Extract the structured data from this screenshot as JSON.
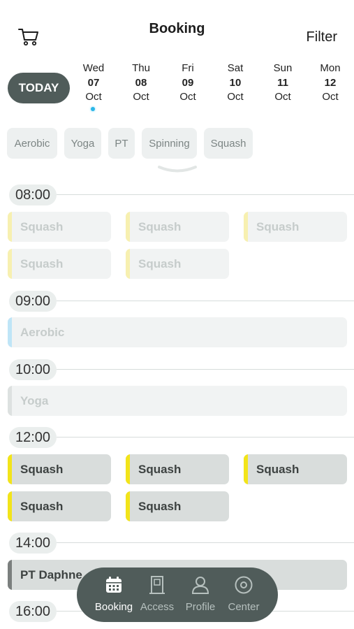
{
  "header": {
    "title": "Booking",
    "filter_label": "Filter",
    "cart_icon": "cart-icon"
  },
  "date_strip": {
    "today_label": "TODAY",
    "selected_index": 0,
    "days": [
      {
        "weekday": "Wed",
        "date": "07",
        "month": "Oct"
      },
      {
        "weekday": "Thu",
        "date": "08",
        "month": "Oct"
      },
      {
        "weekday": "Fri",
        "date": "09",
        "month": "Oct"
      },
      {
        "weekday": "Sat",
        "date": "10",
        "month": "Oct"
      },
      {
        "weekday": "Sun",
        "date": "11",
        "month": "Oct"
      },
      {
        "weekday": "Mon",
        "date": "12",
        "month": "Oct"
      }
    ]
  },
  "categories": [
    "Aerobic",
    "Yoga",
    "PT",
    "Spinning",
    "Squash"
  ],
  "expand_icon": "chevron-down-icon",
  "schedule": {
    "times": [
      "08:00",
      "09:00",
      "10:00",
      "12:00",
      "14:00",
      "16:00"
    ],
    "slots": {
      "s0800_1": "Squash",
      "s0800_2": "Squash",
      "s0800_3": "Squash",
      "s0800_4": "Squash",
      "s0800_5": "Squash",
      "s0900_1": "Aerobic",
      "s1000_1": "Yoga",
      "s1200_1": "Squash",
      "s1200_2": "Squash",
      "s1200_3": "Squash",
      "s1200_4": "Squash",
      "s1200_5": "Squash",
      "s1400_1": "PT Daphne"
    }
  },
  "colors": {
    "accent_dark": "#505c5a",
    "squash": "#f2e41a",
    "aerobic": "#8fd3f2",
    "yoga": "#c9cfce",
    "pt": "#7b7f7e",
    "selected_dot": "#2ab6e8"
  },
  "bottom_nav": [
    {
      "label": "Booking",
      "icon": "calendar-icon",
      "active": true
    },
    {
      "label": "Access",
      "icon": "door-icon",
      "active": false
    },
    {
      "label": "Profile",
      "icon": "user-icon",
      "active": false
    },
    {
      "label": "Center",
      "icon": "location-icon",
      "active": false
    }
  ]
}
